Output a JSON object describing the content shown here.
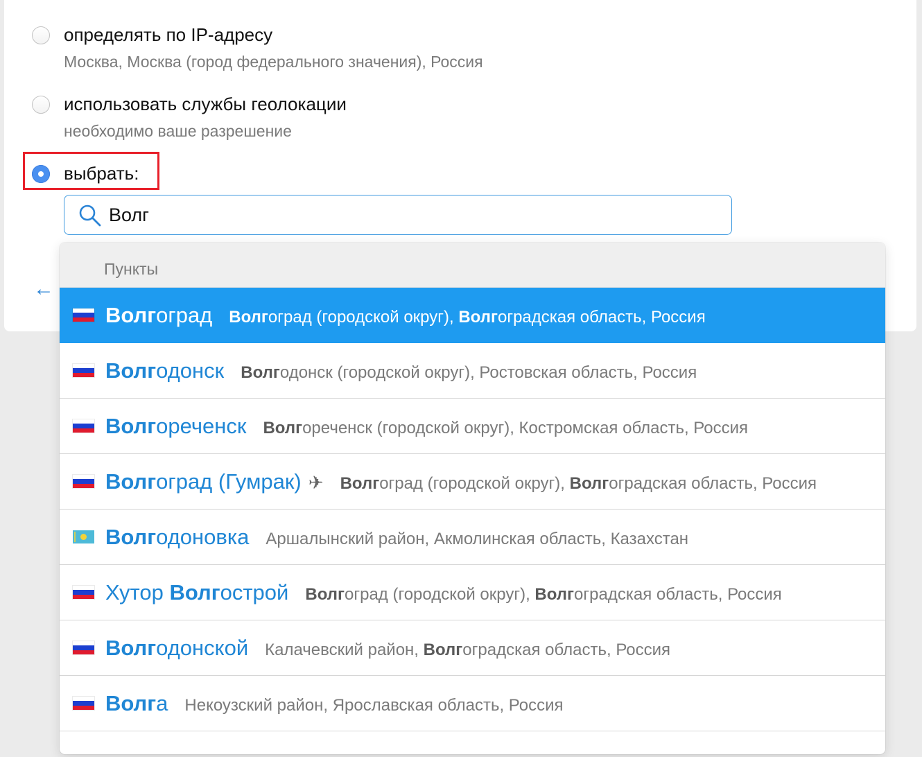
{
  "location": {
    "options": [
      {
        "label": "определять по IP-адресу",
        "sublabel": "Москва, Москва (город федерального значения), Россия",
        "checked": false
      },
      {
        "label": "использовать службы геолокации",
        "sublabel": "необходимо ваше разрешение",
        "checked": false
      },
      {
        "label": "выбрать:",
        "checked": true
      }
    ],
    "search": {
      "value": "Волг",
      "icon": "magnifier"
    },
    "back_icon": "left-arrow"
  },
  "dropdown": {
    "header": "Пункты",
    "items": [
      {
        "flag": "ru",
        "selected": true,
        "city_bold": "Волг",
        "city_rest": "оград",
        "region": [
          {
            "t": "Волг",
            "b": true
          },
          {
            "t": "оград (городской округ), "
          },
          {
            "t": "Волг",
            "b": true
          },
          {
            "t": "оградская область, Россия"
          }
        ]
      },
      {
        "flag": "ru",
        "city_bold": "Волг",
        "city_rest": "одонск",
        "region": [
          {
            "t": "Волг",
            "b": true
          },
          {
            "t": "одонск (городской округ), Ростовская область, Россия"
          }
        ]
      },
      {
        "flag": "ru",
        "city_bold": "Волг",
        "city_rest": "ореченск",
        "region": [
          {
            "t": "Волг",
            "b": true
          },
          {
            "t": "ореченск (городской округ), Костромская область, Россия"
          }
        ]
      },
      {
        "flag": "ru",
        "city_bold": "Волг",
        "city_rest": "оград (Гумрак)",
        "airport": true,
        "region": [
          {
            "t": "Волг",
            "b": true
          },
          {
            "t": "оград (городской округ), "
          },
          {
            "t": "Волг",
            "b": true
          },
          {
            "t": "оградская область, Россия"
          }
        ]
      },
      {
        "flag": "kz",
        "city_bold": "Волг",
        "city_rest": "одоновка",
        "region": [
          {
            "t": "Аршалынский район, Акмолинская область, Казахстан"
          }
        ]
      },
      {
        "flag": "ru",
        "city_pre": "Хутор ",
        "city_bold": "Волг",
        "city_rest": "острой",
        "region": [
          {
            "t": "Волг",
            "b": true
          },
          {
            "t": "оград (городской округ), "
          },
          {
            "t": "Волг",
            "b": true
          },
          {
            "t": "оградская область, Россия"
          }
        ]
      },
      {
        "flag": "ru",
        "city_bold": "Волг",
        "city_rest": "одонской",
        "region": [
          {
            "t": "Калачевский район, "
          },
          {
            "t": "Волг",
            "b": true
          },
          {
            "t": "оградская область, Россия"
          }
        ]
      },
      {
        "flag": "ru",
        "city_bold": "Волг",
        "city_rest": "а",
        "region": [
          {
            "t": "Некоузский район, Ярославская область, Россия"
          }
        ]
      }
    ]
  },
  "colors": {
    "accent": "#1e9bf0",
    "link": "#1f86d5",
    "highlight_border": "#e8202a"
  }
}
